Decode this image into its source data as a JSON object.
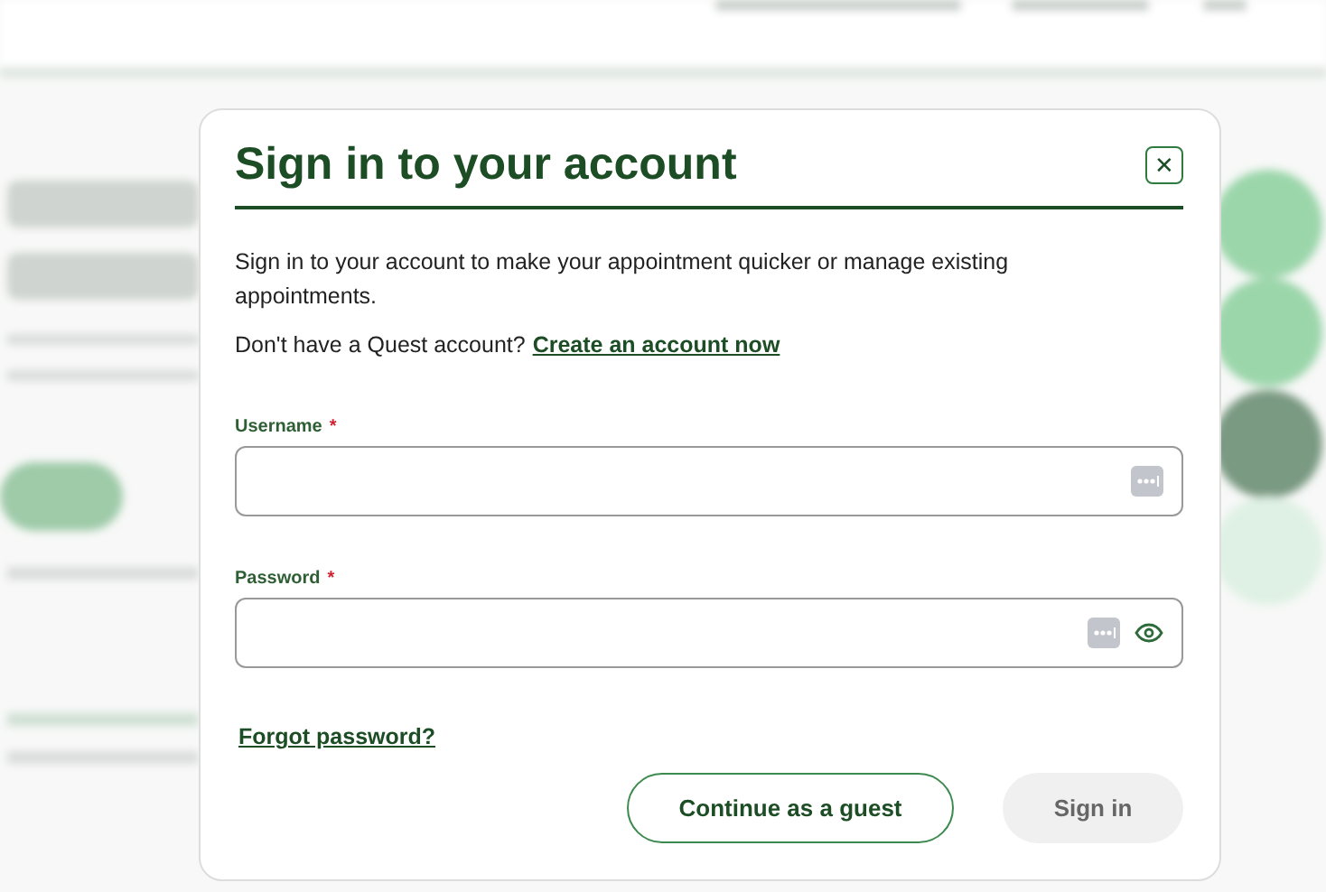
{
  "dialog": {
    "title": "Sign in to your account",
    "close_icon": "✕",
    "intro": "Sign in to your account to make your appointment quicker or manage existing appointments.",
    "prompt": {
      "text": "Don't have a Quest account?",
      "link": "Create an account now"
    },
    "fields": [
      {
        "label": "Username",
        "required_mark": "*",
        "reveal_toggle": false
      },
      {
        "label": "Password",
        "required_mark": "*",
        "reveal_toggle": true
      }
    ],
    "forgot_link": "Forgot password?",
    "buttons": [
      {
        "label": "Continue as a guest",
        "kind": "outline",
        "disabled": false
      },
      {
        "label": "Sign in",
        "kind": "primary",
        "disabled": true
      }
    ]
  }
}
